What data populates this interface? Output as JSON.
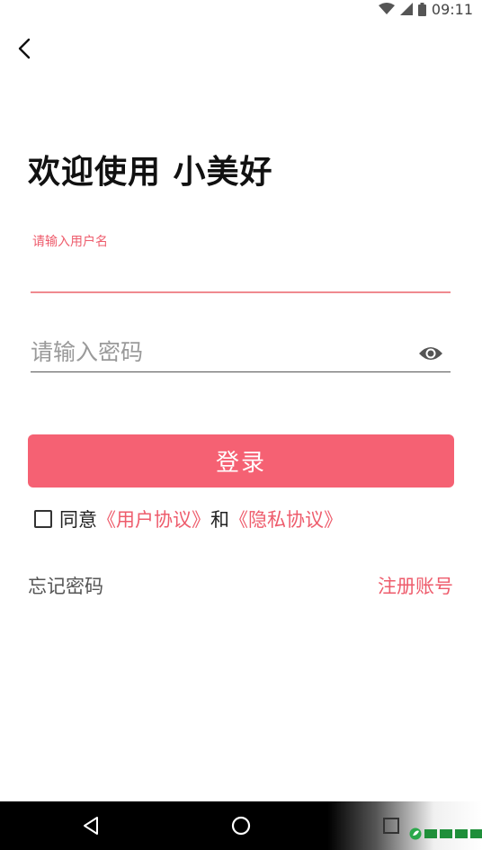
{
  "status_bar": {
    "time": "09:11",
    "icons": [
      "wifi-icon",
      "signal-icon",
      "battery-icon"
    ]
  },
  "header": {
    "back_icon": "chevron-left-icon"
  },
  "page": {
    "title": "欢迎使用 小美好"
  },
  "form": {
    "username": {
      "label": "请输入用户名",
      "value": ""
    },
    "password": {
      "placeholder": "请输入密码",
      "value": "",
      "toggle_icon": "eye-icon"
    },
    "login_label": "登录"
  },
  "agreement": {
    "prefix": "同意",
    "user_agreement": "《用户协议》",
    "conjunction": "和",
    "privacy_policy": "《隐私协议》",
    "checked": false
  },
  "links": {
    "forgot_password": "忘记密码",
    "register": "注册账号"
  },
  "colors": {
    "accent": "#f56173",
    "accent_text": "#ee5c6c"
  },
  "nav_bar": {
    "icons": [
      "nav-back-icon",
      "nav-home-icon",
      "nav-recent-icon"
    ]
  }
}
